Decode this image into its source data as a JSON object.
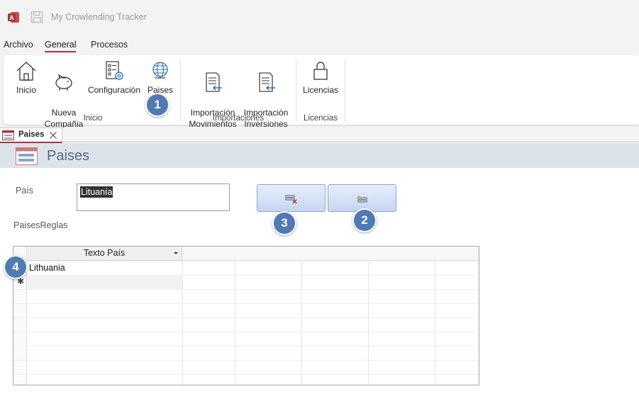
{
  "app": {
    "title": "My Crowlending Tracker",
    "logo_icon": "access-logo-icon",
    "save_icon": "save-icon"
  },
  "menu": {
    "tabs": [
      {
        "label": "Archivo"
      },
      {
        "label": "General"
      },
      {
        "label": "Procesos"
      }
    ],
    "active": "General"
  },
  "ribbon": {
    "groups": [
      {
        "label": "Inicio",
        "buttons": [
          {
            "label": "Inicio",
            "icon": "home-icon"
          },
          {
            "label": "Nueva\nCompañia",
            "icon": "piggy-bank-icon"
          },
          {
            "label": "Configuración",
            "icon": "settings-checklist-icon"
          },
          {
            "label": "Paises",
            "icon": "globe-icon"
          }
        ]
      },
      {
        "label": "Importaciones",
        "buttons": [
          {
            "label": "Importación\nMovimientos",
            "icon": "import-document-icon"
          },
          {
            "label": "Importación\nInversiones",
            "icon": "import-document-icon"
          }
        ]
      },
      {
        "label": "Licencias",
        "buttons": [
          {
            "label": "Licencias",
            "icon": "lock-icon"
          }
        ]
      }
    ]
  },
  "document_tab": {
    "label": "Paises",
    "icon": "form-icon",
    "close_icon": "close-icon"
  },
  "form": {
    "title": "Paises",
    "pais_label": "País",
    "pais_value": "Lituanía",
    "reglas_label": "PaisesReglas",
    "delete_button_icon": "delete-record-icon",
    "new_button_icon": "new-record-icon"
  },
  "subform": {
    "column_header": "Texto País",
    "rows": [
      {
        "texto": "Lithuania"
      }
    ],
    "new_row_marker": "✱"
  },
  "callouts": [
    "1",
    "2",
    "3",
    "4"
  ],
  "colors": {
    "accent": "#a4373a",
    "callout": "#4f7ab3",
    "form_header": "#dde3ea",
    "button": "#c6d6f3"
  }
}
